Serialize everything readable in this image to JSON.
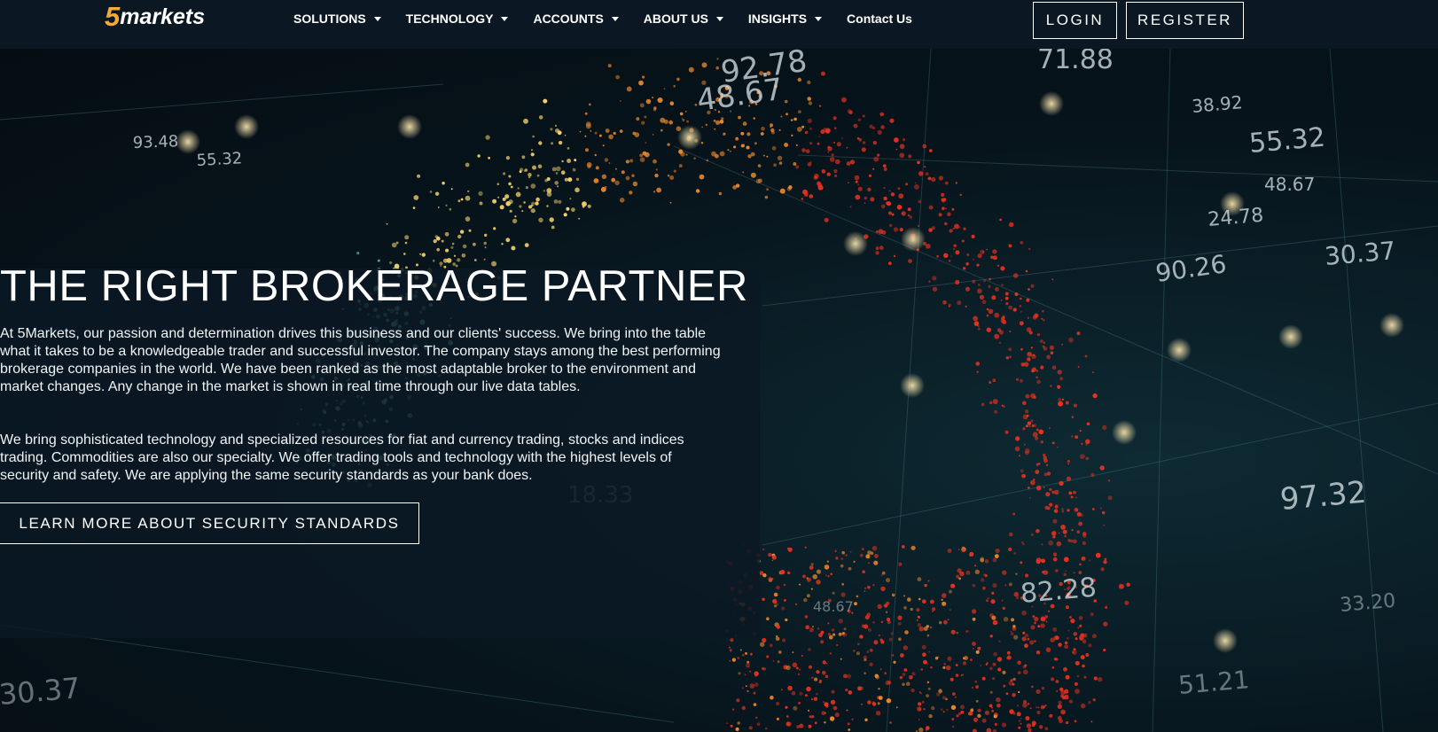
{
  "brand": {
    "logo_number": "5",
    "logo_word": "markets"
  },
  "nav": {
    "items": [
      {
        "label": "SOLUTIONS"
      },
      {
        "label": "TECHNOLOGY"
      },
      {
        "label": "ACCOUNTS"
      },
      {
        "label": "ABOUT US"
      },
      {
        "label": "INSIGHTS"
      }
    ],
    "contact_label": "Contact Us"
  },
  "auth": {
    "login_label": "LOGIN",
    "register_label": "REGISTER"
  },
  "hero": {
    "title": "THE RIGHT BROKERAGE PARTNER",
    "paragraph_1": "At 5Markets, our passion and determination drives this business and our clients' success. We bring into the table what it takes to be a knowledgeable trader and successful investor. The company stays among the best performing brokerage companies in the world. We have been ranked as the most adaptable broker to the environment and market changes. Any change in the market is shown in real time through our live data tables.",
    "paragraph_2": "We bring sophisticated technology and specialized resources for fiat and currency trading, stocks and indices trading. Commodities are also our specialty. We offer trading tools and technology with the highest levels of security and safety. We are applying the same security standards as your bank does.",
    "cta_label": "LEARN MORE ABOUT SECURITY STANDARDS"
  },
  "background_numbers": [
    "92.78",
    "48.67",
    "71.88",
    "38.92",
    "55.32",
    "48.67",
    "24.78",
    "30.37",
    "90.26",
    "93.48",
    "55.32",
    "97.32",
    "82.28",
    "48.67",
    "30.37",
    "51.21",
    "33.20",
    "18.33"
  ],
  "colors": {
    "brand_accent": "#f0a93a",
    "header_bg": "#0b1823",
    "particle_red": "#e8321f",
    "particle_orange": "#f08a2a",
    "particle_yellow": "#f7d36a",
    "particle_teal": "#7fe0c2"
  }
}
